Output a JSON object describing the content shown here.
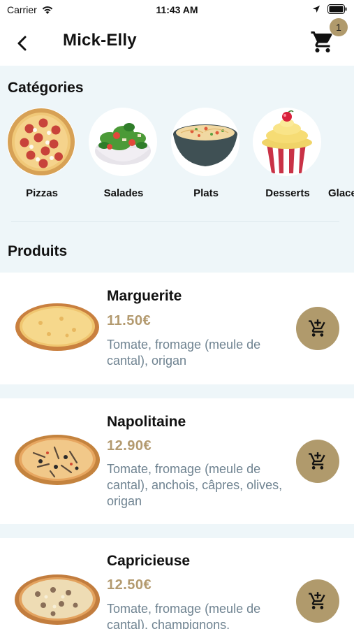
{
  "status_bar": {
    "carrier": "Carrier",
    "time": "11:43 AM"
  },
  "nav": {
    "title": "Mick-Elly",
    "cart_count": "1"
  },
  "categories": {
    "title": "Catégories",
    "items": [
      {
        "label": "Pizzas"
      },
      {
        "label": "Salades"
      },
      {
        "label": "Plats"
      },
      {
        "label": "Desserts"
      },
      {
        "label": "Glaces"
      }
    ]
  },
  "products": {
    "title": "Produits",
    "items": [
      {
        "name": "Marguerite",
        "price": "11.50€",
        "description": "Tomate, fromage (meule de cantal), origan"
      },
      {
        "name": "Napolitaine",
        "price": "12.90€",
        "description": "Tomate, fromage (meule de cantal), anchois, câpres, olives, origan"
      },
      {
        "name": "Capricieuse",
        "price": "12.50€",
        "description": "Tomate, fromage (meule de cantal), champignons,"
      }
    ]
  },
  "colors": {
    "accent": "#b09a6c",
    "price": "#b39a6f",
    "section_bg": "#eef6f9",
    "description": "#6f8391"
  }
}
